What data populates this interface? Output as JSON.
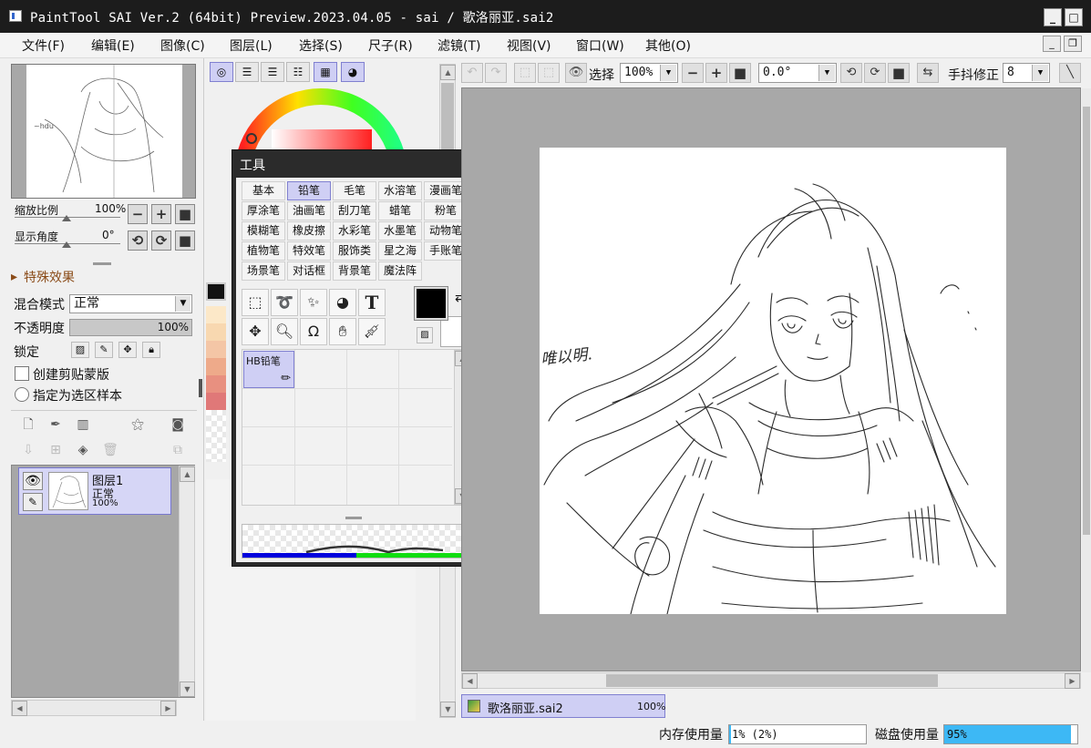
{
  "window": {
    "title": "PaintTool SAI Ver.2 (64bit) Preview.2023.04.05 - sai / 歌洛丽亚.sai2",
    "minimize": "_",
    "maximize": "□",
    "close": "×"
  },
  "menu": [
    "文件(F)",
    "编辑(E)",
    "图像(C)",
    "图层(L)",
    "选择(S)",
    "尺子(R)",
    "滤镜(T)",
    "视图(V)",
    "窗口(W)",
    "其他(O)"
  ],
  "navigator": {
    "zoom_label": "缩放比例",
    "zoom_value": "100%",
    "angle_label": "显示角度",
    "angle_value": "0°"
  },
  "effects": {
    "label": "特殊效果"
  },
  "layer_props": {
    "blend_label": "混合模式",
    "blend_value": "正常",
    "opacity_label": "不透明度",
    "opacity_value": "100%",
    "lock_label": "锁定",
    "clip_label": "创建剪贴蒙版",
    "sample_label": "指定为选区样本"
  },
  "layers": [
    {
      "name": "图层1",
      "mode": "正常",
      "opacity": "100%"
    }
  ],
  "tool_panel": {
    "caption": "工具",
    "tabs": [
      [
        "基本",
        "铅笔",
        "毛笔",
        "水溶笔",
        "漫画笔"
      ],
      [
        "厚涂笔",
        "油画笔",
        "刮刀笔",
        "蜡笔",
        "粉笔"
      ],
      [
        "模糊笔",
        "橡皮擦",
        "水彩笔",
        "水墨笔",
        "动物笔"
      ],
      [
        "植物笔",
        "特效笔",
        "服饰类",
        "星之海",
        "手账笔"
      ],
      [
        "场景笔",
        "对话框",
        "背景笔",
        "魔法阵"
      ]
    ],
    "active_tab": "铅笔",
    "brush_name": "HB铅笔"
  },
  "toolbar": {
    "select_label": "选择",
    "zoom_value": "100%",
    "angle_value": "0.0°",
    "stabilizer_label": "手抖修正",
    "stabilizer_value": "8"
  },
  "canvas": {
    "handwriting": "唯以明."
  },
  "file_tab": {
    "name": "歌洛丽亚.sai2",
    "zoom": "100%"
  },
  "status": {
    "memory_label": "内存使用量",
    "memory_value": "1% (2%)",
    "memory_fill": 0.01,
    "disk_label": "磁盘使用量",
    "disk_value": "95%",
    "disk_fill": 0.95
  },
  "colors": {
    "accent": "#cfcff4",
    "accent_border": "#8080d0",
    "disk_bar": "#3db8f5",
    "titlebar": "#1c1c1c"
  }
}
